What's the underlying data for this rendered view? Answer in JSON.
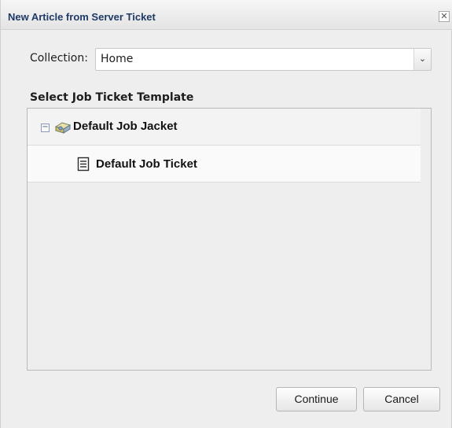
{
  "dialog": {
    "title": "New Article from Server Ticket",
    "close_glyph": "✕"
  },
  "collection": {
    "label": "Collection:",
    "value": "Home",
    "arrow_glyph": "⌄"
  },
  "template_section": {
    "label": "Select Job Ticket Template"
  },
  "tree": {
    "items": [
      {
        "label": "Default Job Jacket",
        "expander": "−",
        "icon": "job-jacket-icon",
        "expanded": true
      },
      {
        "label": "Default Job Ticket",
        "icon": "job-ticket-document-icon"
      }
    ]
  },
  "buttons": {
    "continue_label": "Continue",
    "cancel_label": "Cancel"
  }
}
